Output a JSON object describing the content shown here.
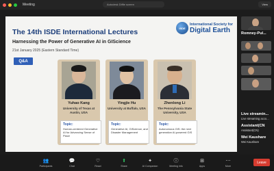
{
  "window": {
    "title": "Meeting",
    "url": "Autodesk Diffie screen",
    "view_label": "View"
  },
  "slide": {
    "title": "The 14th ISDE International Lectures",
    "subtitle": "Harnessing the Power of Generative AI in GIScience",
    "date": "21st January 2025 (Eastern Standard Time)",
    "badge": "Q&A",
    "logo": {
      "circle_text": "ISDE",
      "line1": "International Society for",
      "line2": "Digital Earth"
    },
    "speakers": [
      {
        "name": "Yuhao Kang",
        "affiliation": "University of Texas at Austin, USA",
        "topic_label": "Topic:",
        "topic": "Human-centered Generative AI for Advancing Sense of Place"
      },
      {
        "name": "Yingjie Hu",
        "affiliation": "University at Buffalo, USA",
        "topic_label": "Topic:",
        "topic": "Generative AI, GIScience, and Disaster Management"
      },
      {
        "name": "Zhenlong Li",
        "affiliation": "The Pennsylvania State University, USA",
        "topic_label": "Topic:",
        "topic": "Autonomous GIS: the next generation AI-powered GIS"
      }
    ]
  },
  "side_panel": {
    "participants": [
      {
        "name": "Romney-Pul...",
        "label": "Romney-Pul..."
      },
      {
        "name": "",
        "label": ""
      },
      {
        "name": "",
        "label": ""
      },
      {
        "name": "",
        "label": ""
      }
    ],
    "items": [
      {
        "title": "Live streamin...",
        "sub": "Live streaming acco..."
      },
      {
        "title": "Assistant(CN",
        "sub": "Assistant(CN)"
      },
      {
        "title": "Wei Kaushare",
        "sub": "Wei Kaushare"
      }
    ]
  },
  "toolbar": {
    "items": [
      {
        "icon": "participants-icon",
        "glyph": "👥",
        "label": "Participants"
      },
      {
        "icon": "chat-icon",
        "glyph": "💬",
        "label": "Chat"
      },
      {
        "icon": "react-icon",
        "glyph": "♡",
        "label": "React"
      },
      {
        "icon": "share-icon",
        "glyph": "⬆",
        "label": "Share"
      },
      {
        "icon": "ai-companion-icon",
        "glyph": "✦",
        "label": "AI Companion"
      },
      {
        "icon": "meeting-info-icon",
        "glyph": "ⓘ",
        "label": "Meeting info"
      },
      {
        "icon": "apps-icon",
        "glyph": "⊞",
        "label": "Apps"
      },
      {
        "icon": "more-icon",
        "glyph": "⋯",
        "label": "More"
      }
    ],
    "leave_label": "Leave"
  },
  "colors": {
    "slide_title": "#1b3d7a",
    "badge": "#2f5fb7",
    "card": "#d9c8ad",
    "leave": "#d63c30"
  }
}
